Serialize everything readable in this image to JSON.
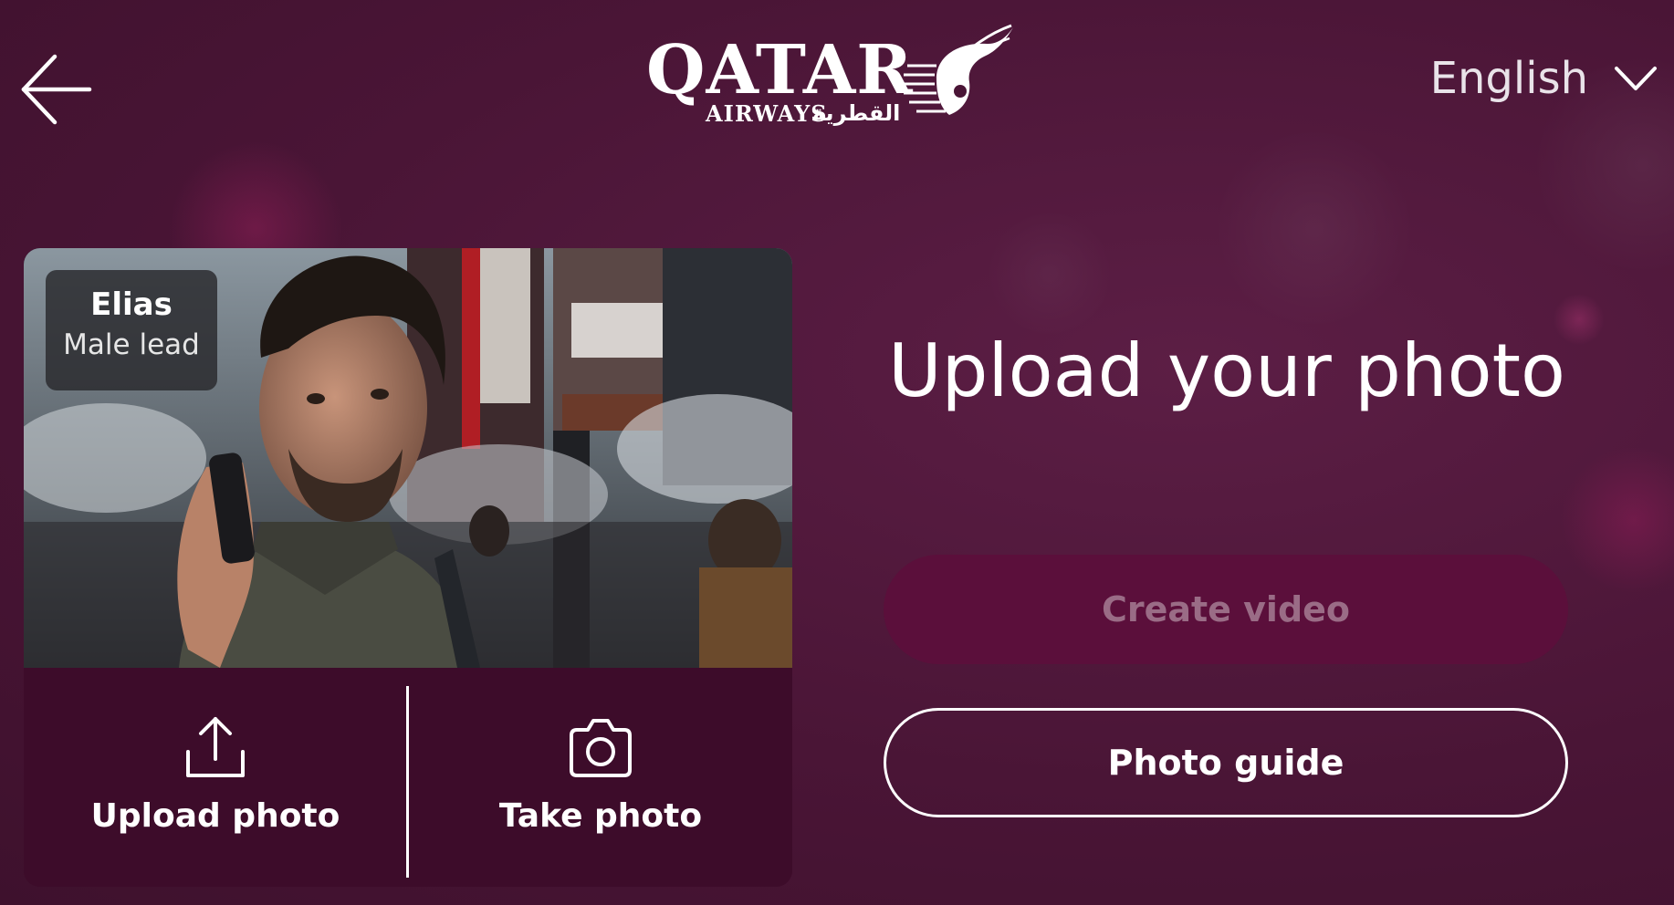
{
  "header": {
    "back_icon": "arrow-left-icon",
    "logo": {
      "main": "QATAR",
      "sub": "AIRWAYS",
      "sub_arabic": "القطرية"
    },
    "language": {
      "selected": "English",
      "icon": "chevron-down-icon"
    }
  },
  "card": {
    "name_tag": {
      "name": "Elias",
      "role": "Male lead"
    },
    "actions": [
      {
        "label": "Upload photo",
        "icon": "upload-icon"
      },
      {
        "label": "Take photo",
        "icon": "camera-icon"
      }
    ]
  },
  "main": {
    "title": "Upload your photo",
    "create_label": "Create video",
    "guide_label": "Photo guide"
  },
  "colors": {
    "background": "#4a1536",
    "card_bottom": "#3d0c2a",
    "create_button": "#5b0f3b",
    "create_text_disabled": "#9a6c86",
    "text": "#ffffff"
  }
}
